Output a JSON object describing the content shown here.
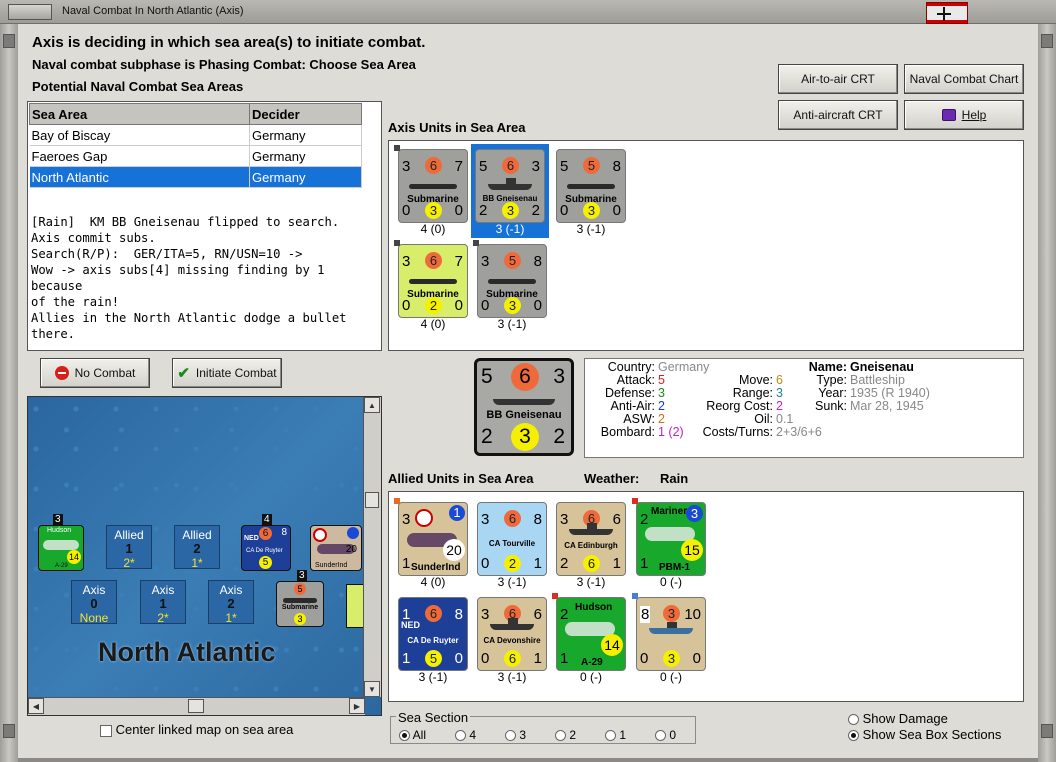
{
  "window": {
    "title": "Naval Combat In North Atlantic (Axis)"
  },
  "header": {
    "line1": "Axis is deciding in which sea area(s) to initiate combat.",
    "line2": "Naval combat subphase is Phasing Combat: Choose Sea Area",
    "line3": "Potential Naval Combat Sea Areas"
  },
  "buttons": {
    "air_to_air": "Air-to-air CRT",
    "naval_chart": "Naval Combat Chart",
    "anti_aircraft": "Anti-aircraft CRT",
    "help": "Help",
    "no_combat": "No Combat",
    "initiate_combat": "Initiate Combat"
  },
  "sea_table": {
    "columns": [
      "Sea Area",
      "Decider"
    ],
    "rows": [
      {
        "area": "Bay of Biscay",
        "decider": "Germany"
      },
      {
        "area": "Faeroes Gap",
        "decider": "Germany"
      },
      {
        "area": "North Atlantic",
        "decider": "Germany"
      }
    ],
    "log": "[Rain]  KM BB Gneisenau flipped to search.\nAxis commit subs.\nSearch(R/P):  GER/ITA=5, RN/USN=10 ->\nWow -> axis subs[4] missing finding by 1 because\nof the rain!\nAllies in the North Atlantic dodge a bullet there."
  },
  "axis_units": {
    "label": "Axis Units in Sea Area",
    "units": [
      {
        "name": "Submarine",
        "tl": "3",
        "top": "6",
        "tr": "7",
        "bl": "0",
        "bot": "3",
        "br": "0",
        "caption": "4 (0)"
      },
      {
        "name": "BB Gneisenau",
        "tl": "5",
        "top": "6",
        "tr": "3",
        "bl": "2",
        "bot": "3",
        "br": "2",
        "caption": "3 (-1)"
      },
      {
        "name": "Submarine",
        "tl": "5",
        "top": "5",
        "tr": "8",
        "bl": "0",
        "bot": "3",
        "br": "0",
        "caption": "3 (-1)"
      },
      {
        "name": "Submarine",
        "tl": "3",
        "top": "6",
        "tr": "7",
        "bl": "0",
        "bot": "2",
        "br": "0",
        "caption": "4 (0)"
      },
      {
        "name": "Submarine",
        "tl": "3",
        "top": "5",
        "tr": "8",
        "bl": "0",
        "bot": "3",
        "br": "0",
        "caption": "3 (-1)"
      }
    ]
  },
  "selected_unit": {
    "tl": "5",
    "top": "6",
    "tr": "3",
    "name": "BB Gneisenau",
    "bl": "2",
    "bot": "3",
    "br": "2",
    "country_label": "Country:",
    "country": "Germany",
    "attack_label": "Attack:",
    "attack": "5",
    "defense_label": "Defense:",
    "defense": "3",
    "anti_air_label": "Anti-Air:",
    "anti_air": "2",
    "asw_label": "ASW:",
    "asw": "2",
    "bombard_label": "Bombard:",
    "bombard": "1 (2)",
    "move_label": "Move:",
    "move": "6",
    "range_label": "Range:",
    "range": "3",
    "reorg_label": "Reorg Cost:",
    "reorg": "2",
    "oil_label": "Oil:",
    "oil": "0.1",
    "costs_label": "Costs/Turns:",
    "costs": "2+3/6+6",
    "name_label": "Name:",
    "name_value": "Gneisenau",
    "type_label": "Type:",
    "type": "Battleship",
    "year_label": "Year:",
    "year": "1935 (R 1940)",
    "sunk_label": "Sunk:",
    "sunk": "Mar 28, 1945"
  },
  "allied_units": {
    "label": "Allied Units in Sea Area",
    "weather_label": "Weather:",
    "weather": "Rain",
    "units": [
      {
        "name": "SunderInd",
        "tl": "3",
        "top": "",
        "tr": "1",
        "bl": "1",
        "bot": "",
        "br": "20",
        "caption": "4 (0)"
      },
      {
        "name": "CA Tourville",
        "tl": "3",
        "top": "6",
        "tr": "8",
        "bl": "0",
        "bot": "2",
        "br": "1",
        "caption": "3 (-1)"
      },
      {
        "name": "CA Edinburgh",
        "tl": "3",
        "top": "6",
        "tr": "6",
        "bl": "2",
        "bot": "6",
        "br": "1",
        "caption": "3 (-1)"
      },
      {
        "name": "Mariner",
        "tl": "2",
        "top": "",
        "tr": "3",
        "bl": "1",
        "bot": "15",
        "br": "PBM-1",
        "caption": "0 (-)"
      },
      {
        "name": "CA De Ruyter",
        "tl": "1",
        "top": "6",
        "tr": "8",
        "bl": "1",
        "bot": "5",
        "br": "0",
        "caption": "3 (-1)"
      },
      {
        "name": "CA Devonshire",
        "tl": "3",
        "top": "6",
        "tr": "6",
        "bl": "0",
        "bot": "6",
        "br": "1",
        "caption": "3 (-1)"
      },
      {
        "name": "Hudson",
        "tl": "2",
        "top": "",
        "tr": "",
        "bl": "1",
        "bot": "14",
        "br": "A-29",
        "caption": "0 (-)"
      },
      {
        "name": "",
        "tl": "8",
        "top": "3",
        "tr": "10",
        "bl": "0",
        "bot": "3",
        "br": "0",
        "caption": "0 (-)"
      }
    ]
  },
  "map": {
    "sea_name": "North Atlantic",
    "allied_boxes": [
      {
        "title": "Allied",
        "num": "1",
        "val": "2*"
      },
      {
        "title": "Allied",
        "num": "2",
        "val": "1*"
      }
    ],
    "axis_boxes": [
      {
        "title": "Axis",
        "num": "0",
        "val": "None"
      },
      {
        "title": "Axis",
        "num": "1",
        "val": "2*"
      },
      {
        "title": "Axis",
        "num": "2",
        "val": "1*"
      }
    ],
    "map_units": [
      {
        "label": "Hudson",
        "stack": "3",
        "code": "A-29",
        "num": "14"
      },
      {
        "label": "CA De Ruyter",
        "stack": "4",
        "tag": "NED",
        "a": "6",
        "b": "8",
        "c": "5"
      },
      {
        "label": "SunderInd",
        "stack": "",
        "num": "20"
      },
      {
        "label": "Submarine",
        "stack": "3",
        "a": "5",
        "b": "3"
      }
    ],
    "center_linked": "Center linked map on sea area"
  },
  "sea_section": {
    "label": "Sea Section",
    "options": [
      "All",
      "4",
      "3",
      "2",
      "1",
      "0"
    ],
    "selected": "All"
  },
  "display_options": {
    "show_damage": "Show Damage",
    "show_sea_box": "Show Sea Box Sections",
    "selected": "Show Sea Box Sections"
  }
}
